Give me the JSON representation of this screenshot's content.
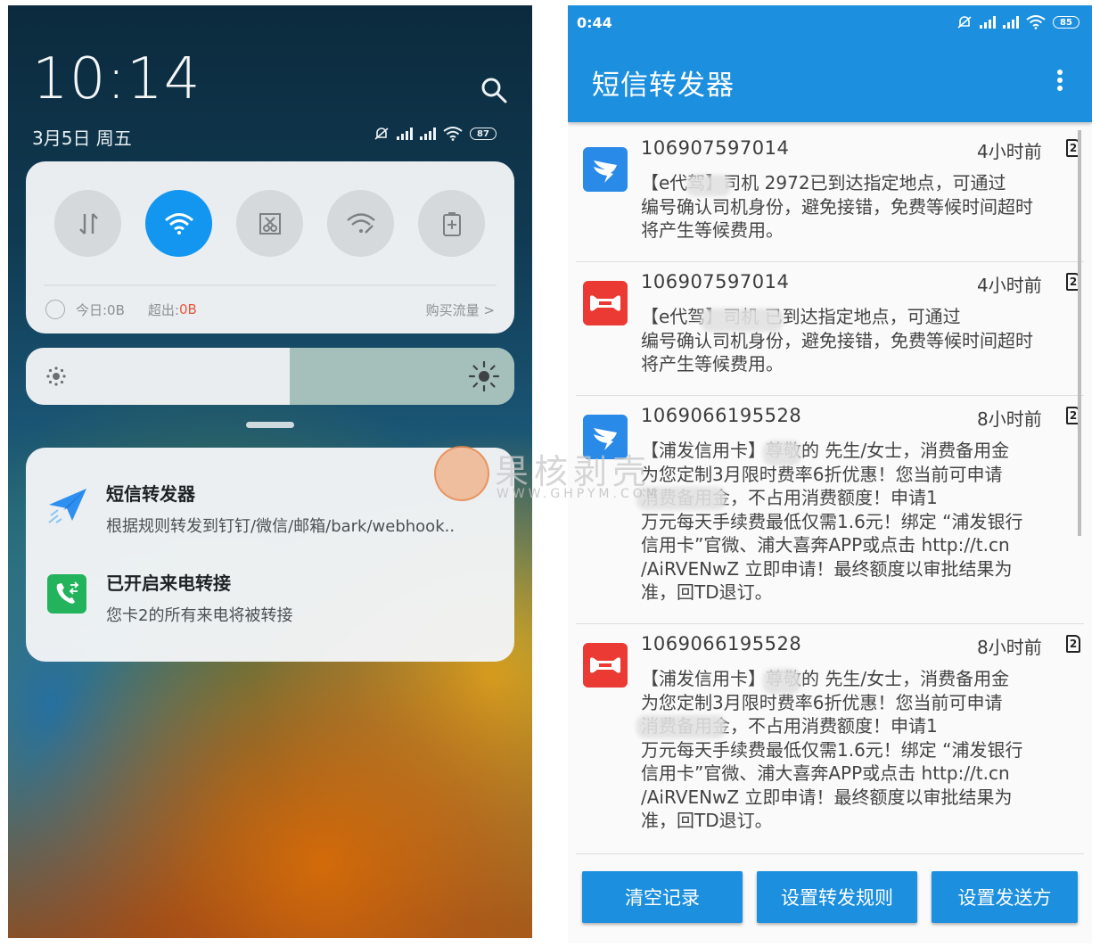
{
  "left": {
    "clock": "10:14",
    "date": "3月5日 周五",
    "battery": "87",
    "data_usage": {
      "today_label": "今日:0B",
      "exceed_label": "超出:",
      "exceed_value": "0B",
      "buy": "购买流量 >"
    },
    "brightness_level": 0.54,
    "notifications": [
      {
        "title": "短信转发器",
        "body": "根据规则转发到钉钉/微信/邮箱/bark/webhook.."
      },
      {
        "title": "已开启来电转接",
        "body": "您卡2的所有来电将被转接"
      }
    ],
    "colors": {
      "accent": "#1296f0",
      "exceed": "#e8563b"
    }
  },
  "right": {
    "status_time": "0:44",
    "battery": "85",
    "app_title": "短信转发器",
    "messages": [
      {
        "number": "106907597014",
        "time": "4小时前",
        "sim": "2",
        "icon": "dingtalk-icon",
        "body": "【e代驾】司机     2972已到达指定地点，可通过\n编号确认司机身份，避免接错，免费等候时间超时\n将产生等候费用。"
      },
      {
        "number": "106907597014",
        "time": "4小时前",
        "sim": "2",
        "icon": "wecom-bone-icon",
        "body": "【e代驾】司机          已到达指定地点，可通过\n编号确认司机身份，避免接错，免费等候时间超时\n将产生等候费用。"
      },
      {
        "number": "1069066195528",
        "time": "8小时前",
        "sim": "2",
        "icon": "dingtalk-icon",
        "body": "【浦发信用卡】尊敬的   先生/女士，消费备用金\n为您定制3月限时费率6折优惠！您当前可申请\n        消费备用金，不占用消费额度！申请1\n万元每天手续费最低仅需1.6元！绑定 “浦发银行\n信用卡”官微、浦大喜奔APP或点击 http://t.cn\n/AiRVENwZ 立即申请！最终额度以审批结果为\n准，回TD退订。"
      },
      {
        "number": "1069066195528",
        "time": "8小时前",
        "sim": "2",
        "icon": "wecom-bone-icon",
        "body": "【浦发信用卡】尊敬的   先生/女士，消费备用金\n为您定制3月限时费率6折优惠！您当前可申请\n        消费备用金，不占用消费额度！申请1\n万元每天手续费最低仅需1.6元！绑定 “浦发银行\n信用卡”官微、浦大喜奔APP或点击 http://t.cn\n/AiRVENwZ 立即申请！最终额度以审批结果为\n准，回TD退订。"
      }
    ],
    "buttons": [
      "清空记录",
      "设置转发规则",
      "设置发送方"
    ],
    "colors": {
      "primary": "#1c8fde",
      "dingtalk": "#2a8ae8",
      "wecom": "#eb3a33"
    }
  },
  "watermark": {
    "text": "果核剥壳",
    "sub": "WWW.GHPYM.COM"
  }
}
